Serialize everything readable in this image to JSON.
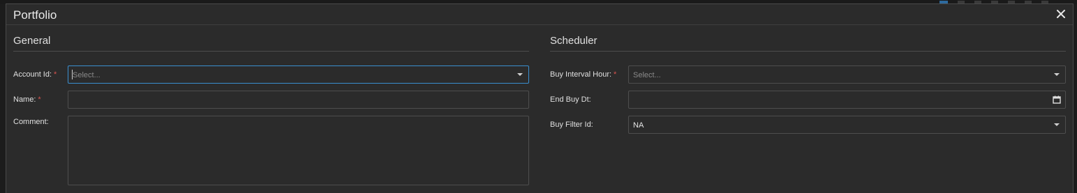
{
  "window": {
    "title": "Portfolio"
  },
  "general": {
    "heading": "General",
    "account_id": {
      "label": "Account Id:",
      "required": "*",
      "placeholder": "Select..."
    },
    "name": {
      "label": "Name:",
      "required": "*",
      "value": ""
    },
    "comment": {
      "label": "Comment:",
      "value": ""
    }
  },
  "scheduler": {
    "heading": "Scheduler",
    "buy_interval_hour": {
      "label": "Buy Interval Hour:",
      "required": "*",
      "placeholder": "Select..."
    },
    "end_buy_dt": {
      "label": "End Buy Dt:",
      "value": ""
    },
    "buy_filter_id": {
      "label": "Buy Filter Id:",
      "value": "NA"
    }
  },
  "icons": {
    "close": "close-icon",
    "dropdown": "chevron-down-icon",
    "calendar": "calendar-icon"
  },
  "colors": {
    "background": "#2b2b2b",
    "focus_border": "#3a8fd0",
    "required": "#d9534f"
  }
}
